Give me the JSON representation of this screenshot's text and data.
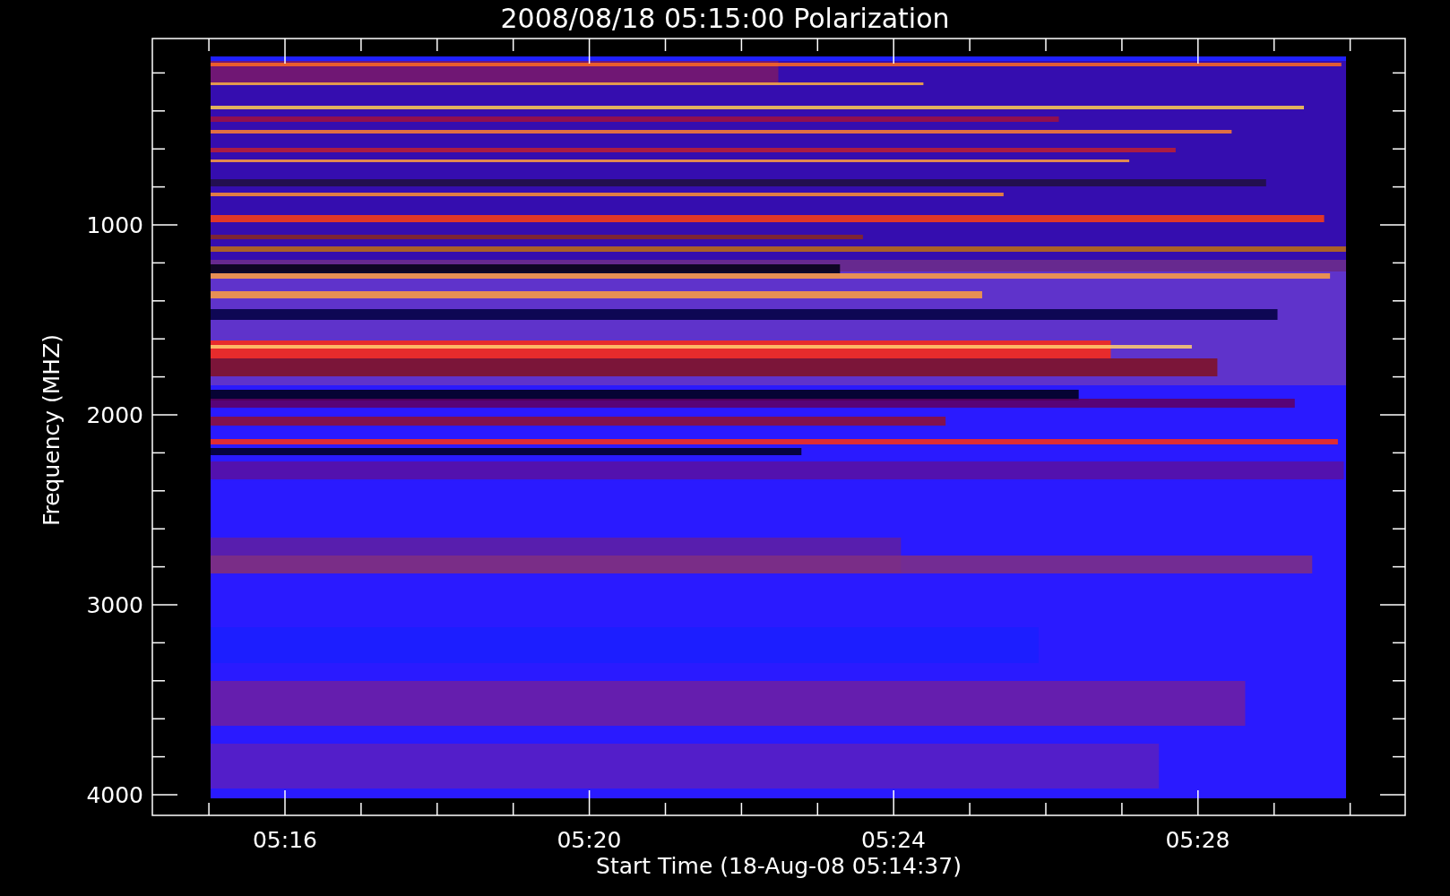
{
  "title": "2008/08/18 05:15:00 Polarization",
  "y_axis": {
    "label": "Frequency (MHZ)",
    "ticks": [
      "1000",
      "2000",
      "3000",
      "4000"
    ]
  },
  "x_axis": {
    "label": "Start Time (18-Aug-08 05:14:37)",
    "ticks": [
      "05:16",
      "05:20",
      "05:24",
      "05:28"
    ]
  }
}
